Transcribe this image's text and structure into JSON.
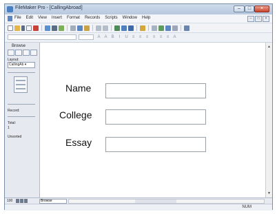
{
  "window": {
    "title": "FileMaker Pro - [CallingAbroad]",
    "controls": [
      "–",
      "□",
      "×"
    ]
  },
  "menubar": {
    "items": [
      "File",
      "Edit",
      "View",
      "Insert",
      "Format",
      "Records",
      "Scripts",
      "Window",
      "Help"
    ],
    "mdi_controls": [
      "–",
      "□",
      "×"
    ]
  },
  "status_area": {
    "mode": "Browse",
    "layout_label": "Layout:",
    "layout_value": "CallingAb ▾",
    "record_label": "Record:",
    "total_label": "Total:",
    "total_value": "1",
    "unsorted_label": "Unsorted"
  },
  "form": {
    "fields": [
      {
        "label": "Name",
        "value": ""
      },
      {
        "label": "College",
        "value": ""
      },
      {
        "label": "Essay",
        "value": ""
      }
    ]
  },
  "bottombar": {
    "zoom": "100",
    "mode": "Browse"
  },
  "statusbar": {
    "indicator": "NUM"
  },
  "format_icons": [
    "A",
    "A",
    "B",
    "I",
    "U",
    "≡",
    "≡",
    "≡",
    "≡",
    "≡",
    "≡",
    "A"
  ],
  "colors": {
    "accent": "#4a7fc1",
    "window_border": "#7a8ea8",
    "close": "#c9452c"
  }
}
